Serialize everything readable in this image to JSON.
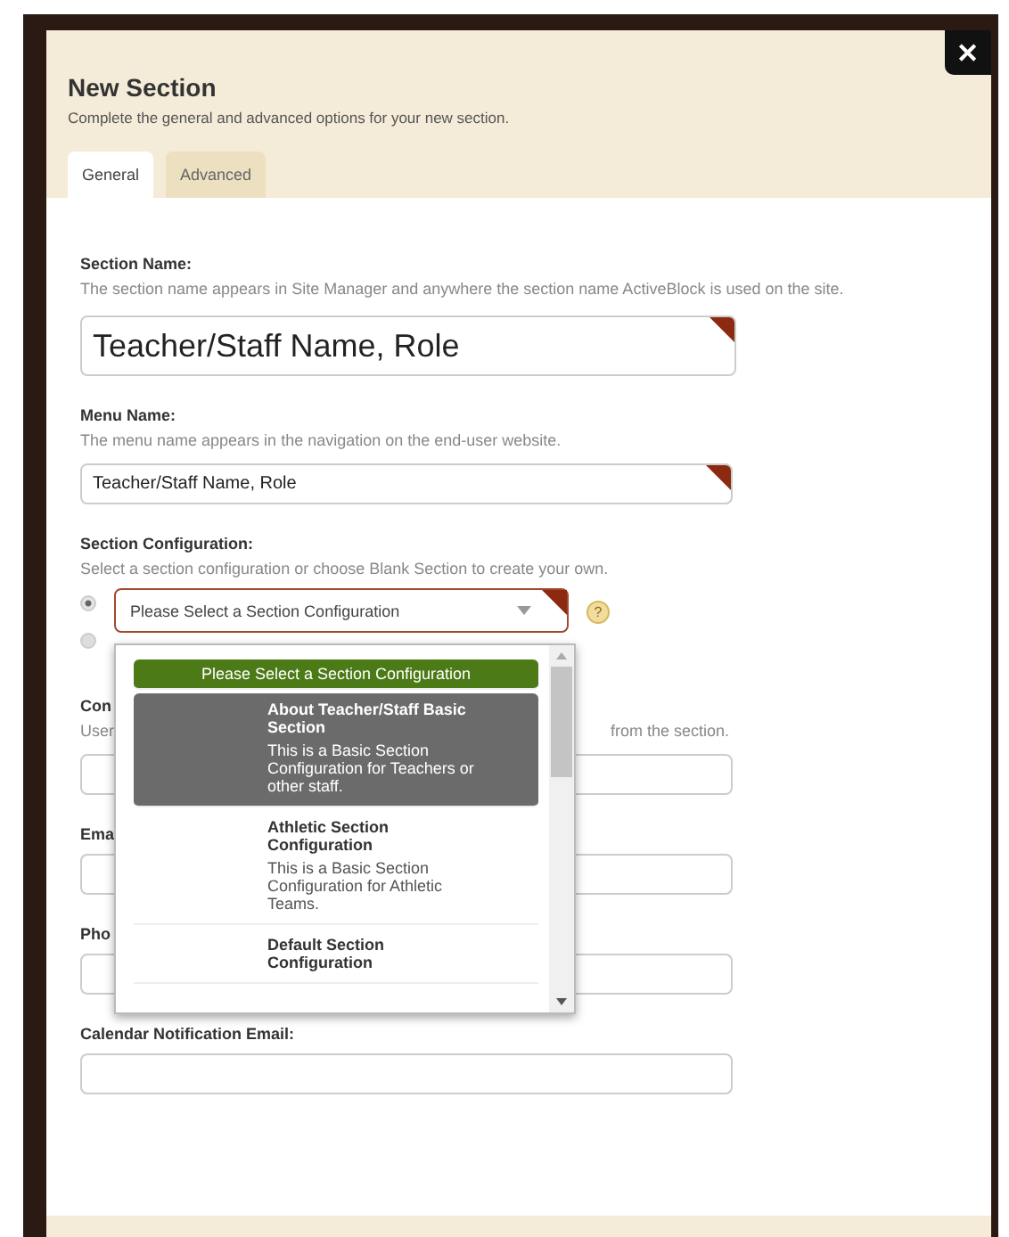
{
  "dialog": {
    "title": "New Section",
    "subtitle": "Complete the general and advanced options for your new section.",
    "close": "✕"
  },
  "tabs": [
    {
      "label": "General",
      "selected": true
    },
    {
      "label": "Advanced",
      "selected": false
    }
  ],
  "section_name": {
    "label": "Section Name:",
    "hint": "The section name appears in Site Manager and anywhere the section name ActiveBlock is used on the site.",
    "value": "Teacher/Staff Name, Role"
  },
  "menu_name": {
    "label": "Menu Name:",
    "hint": "The menu name appears in the navigation on the end-user website.",
    "value": "Teacher/Staff Name, Role"
  },
  "section_configuration": {
    "label": "Section Configuration:",
    "hint": "Select a section configuration or choose Blank Section to create your own.",
    "radios": [
      {
        "selected": true
      },
      {
        "selected": false
      }
    ],
    "select_value": "Please Select a Section Configuration",
    "help": "?",
    "options": [
      {
        "title": "Please Select a Section Configuration",
        "selected": true,
        "highlighted": false
      },
      {
        "title": "About Teacher/Staff Basic Section",
        "description": "This is a Basic Section Configuration for Teachers or other staff.",
        "selected": false,
        "highlighted": true
      },
      {
        "title": "Athletic Section Configuration",
        "description": "This is a Basic Section Configuration for Athletic Teams.",
        "selected": false,
        "highlighted": false
      },
      {
        "title": "Default Section Configuration",
        "selected": false,
        "highlighted": false
      }
    ]
  },
  "fields": [
    {
      "label": "Con",
      "hint_start": "User",
      "hint_end": "from the section."
    },
    {
      "label": "Ema"
    },
    {
      "label": "Pho"
    },
    {
      "label": "Calendar Notification Email:"
    }
  ]
}
